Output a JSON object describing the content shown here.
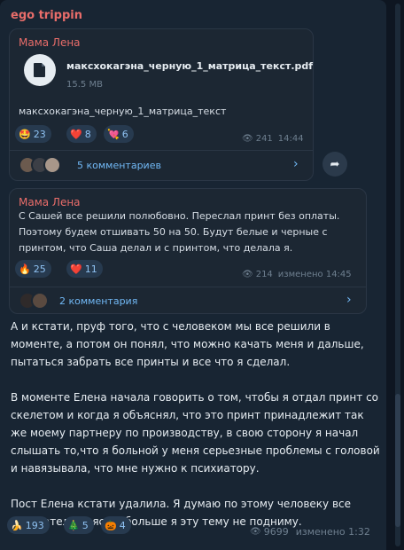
{
  "channel": {
    "name": "ego trippin"
  },
  "post1": {
    "sender": "Мама Лена",
    "file": {
      "name": "максхокагэна_черную_1_матрица_текст.pdf",
      "size": "15.5 MB"
    },
    "caption": "максхокагэна_черную_1_матрица_текст",
    "reactions": [
      {
        "emoji": "🤩",
        "count": "23"
      },
      {
        "emoji": "❤️",
        "count": "8"
      },
      {
        "emoji": "💘",
        "count": "6"
      }
    ],
    "views": "241",
    "time": "14:44",
    "comments": "5 комментариев"
  },
  "post2": {
    "sender": "Мама Лена",
    "text": "С Сашей все решили полюбовно. Переслал принт без оплаты. Поэтому будем отшивать 50 на 50. Будут белые и черные с принтом, что Саша делал и с принтом, что делала я.",
    "reactions": [
      {
        "emoji": "🔥",
        "count": "25"
      },
      {
        "emoji": "❤️",
        "count": "11"
      }
    ],
    "views": "214",
    "time": "изменено 14:45",
    "comments": "2 комментария"
  },
  "main_post": {
    "paragraphs": [
      "А и кстати, пруф того, что с человеком мы все решили в моменте, а потом он понял, что можно качать меня и дальше, пытаться забрать все принты и все что я сделал.",
      "В моменте Елена начала говорить о том, чтобы я отдал принт со скелетом и когда я объяснял, что это принт принадлежит так же моему партнеру по производству, в свою сторону я начал слышать то,что я больной у меня серьезные проблемы с головой и навязывала, что мне нужно к психиатору.",
      "Пост Елена кстати удалила. Я думаю по этому человеку все окончательно ясно, больше я эту тему не подниму."
    ],
    "reactions": [
      {
        "emoji": "🍌",
        "count": "193"
      },
      {
        "emoji": "🎄",
        "count": "5"
      },
      {
        "emoji": "🎃",
        "count": "4"
      }
    ],
    "views": "9699",
    "time": "изменено 1:32"
  },
  "icons": {
    "file": "file-icon",
    "eye": "eye-icon",
    "share": "share-icon",
    "chevron": "chevron-right-icon"
  },
  "colors": {
    "accent": "#71b8f5",
    "sender": "#e96d6a",
    "bubble": "#182533",
    "background": "#0e1621"
  }
}
